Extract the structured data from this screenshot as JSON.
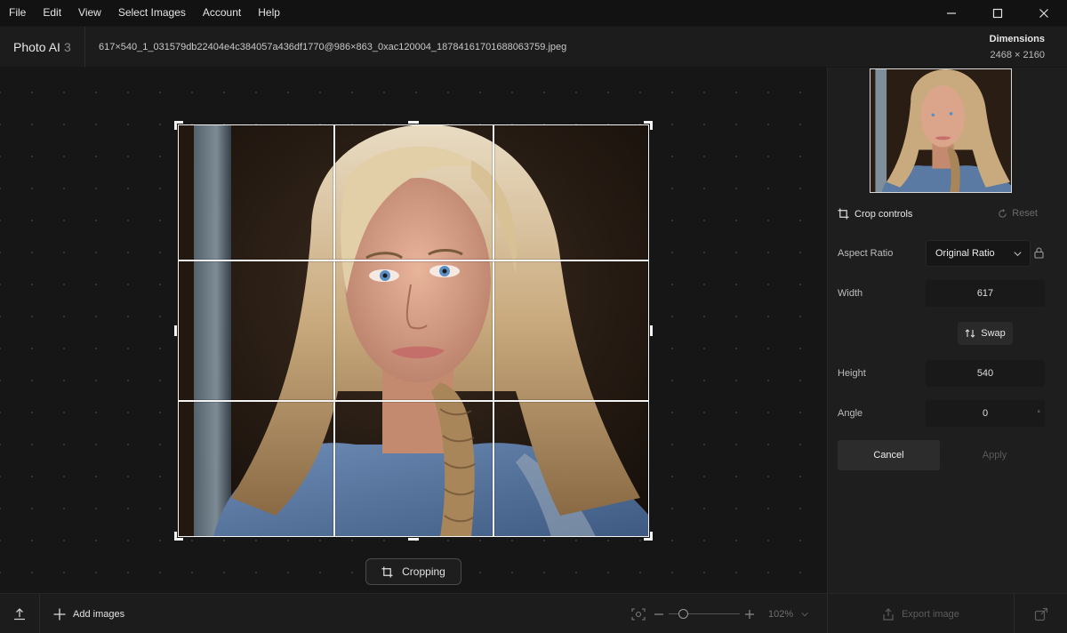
{
  "menu": {
    "items": [
      "File",
      "Edit",
      "View",
      "Select Images",
      "Account",
      "Help"
    ]
  },
  "window": {
    "minimize_icon": "minimize-icon",
    "maximize_icon": "maximize-icon",
    "close_icon": "close-icon"
  },
  "header": {
    "app_name": "Photo AI",
    "app_version": "3",
    "filename": "617×540_1_031579db22404e4c384057a436df1770@986×863_0xac120004_18784161701688063759.jpeg",
    "dimensions_label": "Dimensions",
    "dimensions_value": "2468 × 2160"
  },
  "canvas": {
    "cropping_label": "Cropping"
  },
  "panel": {
    "crop_controls_label": "Crop controls",
    "reset_label": "Reset",
    "aspect_ratio_label": "Aspect Ratio",
    "aspect_ratio_value": "Original Ratio",
    "width_label": "Width",
    "width_value": "617",
    "swap_label": "Swap",
    "height_label": "Height",
    "height_value": "540",
    "angle_label": "Angle",
    "angle_value": "0",
    "angle_unit": "°",
    "cancel_label": "Cancel",
    "apply_label": "Apply"
  },
  "bottom": {
    "add_images_label": "Add images",
    "zoom_value": "102%",
    "zoom_level": 0.2,
    "export_label": "Export image"
  },
  "colors": {
    "background": "#161616",
    "panel": "#1e1e1e",
    "crop_frame": "#f4f4f4"
  }
}
